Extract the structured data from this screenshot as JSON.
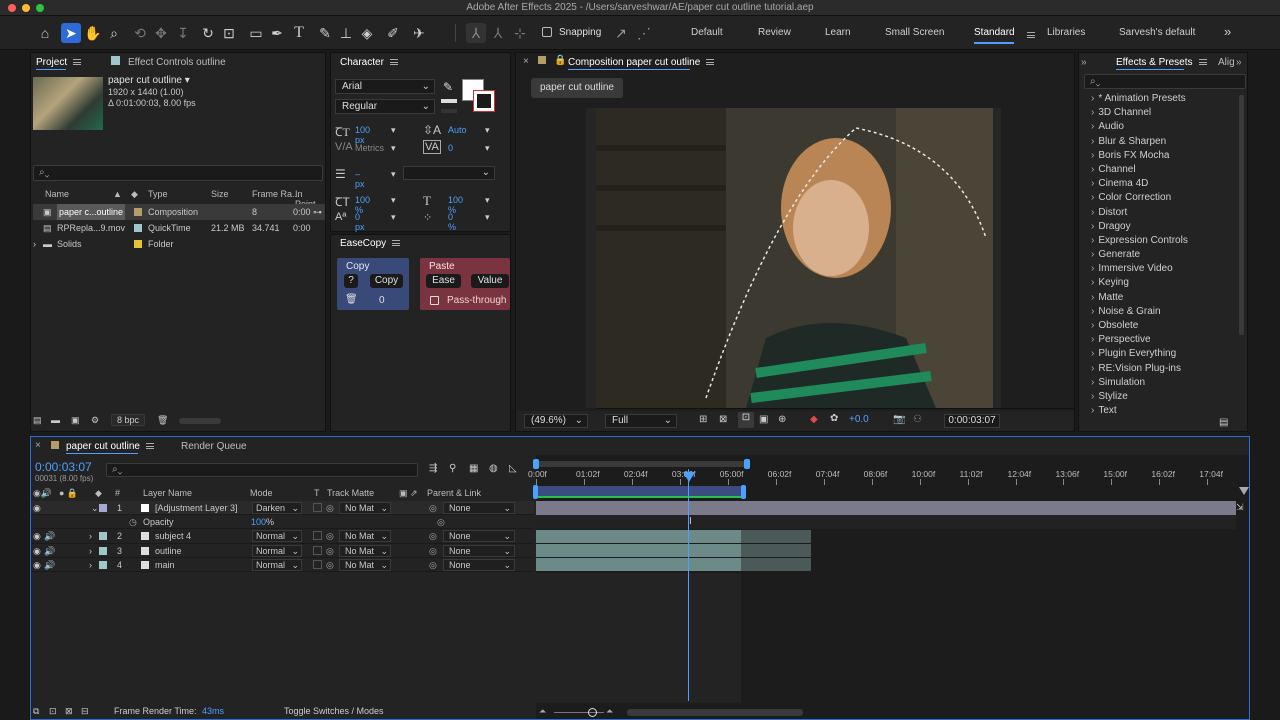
{
  "window": {
    "title": "Adobe After Effects 2025 - /Users/sarveshwar/AE/paper cut outline tutorial.aep"
  },
  "toolbar": {
    "snapping_label": "Snapping",
    "workspaces": [
      "Default",
      "Review",
      "Learn",
      "Small Screen",
      "Standard",
      "Libraries",
      "Sarvesh's default"
    ],
    "active_workspace": "Standard"
  },
  "project": {
    "tab": "Project",
    "effect_controls_tab": "Effect Controls outline",
    "item_name": "paper cut outline ▾",
    "item_dims": "1920 x 1440 (1.00)",
    "item_duration": "Δ 0:01:00:03, 8.00 fps",
    "columns": [
      "Name",
      "Type",
      "Size",
      "Frame Ra...",
      "In Point"
    ],
    "rows": [
      {
        "name": "paper c...outline",
        "type": "Composition",
        "size": "",
        "fps": "8",
        "in": "0:00",
        "color": "#b59d6a"
      },
      {
        "name": "RPRepla...9.mov",
        "type": "QuickTime",
        "size": "21.2 MB",
        "fps": "34.741",
        "in": "0:00",
        "color": "#9fc7c9"
      },
      {
        "name": "Solids",
        "type": "Folder",
        "size": "",
        "fps": "",
        "in": "",
        "color": "#e6c13a"
      }
    ],
    "bpc": "8 bpc"
  },
  "character": {
    "tab": "Character",
    "font": "Arial",
    "style": "Regular",
    "size": "100 px",
    "leading": "Auto",
    "kerning": "Metrics",
    "tracking": "0",
    "stroke": "– px",
    "vscale": "100 %",
    "hscale": "100 %",
    "baseline": "0 px",
    "tsume": "0 %"
  },
  "easecopy": {
    "tab": "EaseCopy",
    "copy_title": "Copy",
    "q_label": "?",
    "copy_button": "Copy",
    "count": "0",
    "paste_title": "Paste",
    "ease_button": "Ease",
    "value_button": "Value",
    "passthrough_label": "Pass-through"
  },
  "composition": {
    "tab": "Composition paper cut outline",
    "breadcrumb": "paper cut outline",
    "zoom": "(49.6%)",
    "resolution": "Full",
    "exposure": "+0.0",
    "timecode": "0:00:03:07"
  },
  "effects": {
    "tab": "Effects & Presets",
    "tab2": "Alig",
    "items": [
      "* Animation Presets",
      "3D Channel",
      "Audio",
      "Blur & Sharpen",
      "Boris FX Mocha",
      "Channel",
      "Cinema 4D",
      "Color Correction",
      "Distort",
      "Dragoy",
      "Expression Controls",
      "Generate",
      "Immersive Video",
      "Keying",
      "Matte",
      "Noise & Grain",
      "Obsolete",
      "Perspective",
      "Plugin Everything",
      "RE:Vision Plug-ins",
      "Simulation",
      "Stylize",
      "Text"
    ]
  },
  "timeline": {
    "tab": "paper cut outline",
    "render_queue_tab": "Render Queue",
    "timecode": "0:00:03:07",
    "frame_info": "00031 (8.00 fps)",
    "headers": {
      "layer_name": "Layer Name",
      "mode": "Mode",
      "t": "T",
      "track_matte": "Track Matte",
      "parent": "Parent & Link"
    },
    "ruler": [
      "0:00f",
      "01:02f",
      "02:04f",
      "03:06f",
      "05:00f",
      "06:02f",
      "07:04f",
      "08:06f",
      "10:00f",
      "11:02f",
      "12:04f",
      "13:06f",
      "15:00f",
      "16:02f",
      "17:04f"
    ],
    "layers": [
      {
        "num": "1",
        "name": "[Adjustment Layer 3]",
        "mode": "Darken",
        "matte": "No Mat",
        "parent": "None",
        "color": "#a8a8d8"
      },
      {
        "num": "2",
        "name": "subject 4",
        "mode": "Normal",
        "matte": "No Mat",
        "parent": "None",
        "color": "#9fc7c9"
      },
      {
        "num": "3",
        "name": "outline",
        "mode": "Normal",
        "matte": "No Mat",
        "parent": "None",
        "color": "#9fc7c9"
      },
      {
        "num": "4",
        "name": "main",
        "mode": "Normal",
        "matte": "No Mat",
        "parent": "None",
        "color": "#9fc7c9"
      }
    ],
    "opacity_label": "Opacity",
    "opacity_value": "100",
    "opacity_unit": "%",
    "frame_render_label": "Frame Render Time:",
    "frame_render_value": "43ms",
    "toggle_label": "Toggle Switches / Modes"
  }
}
